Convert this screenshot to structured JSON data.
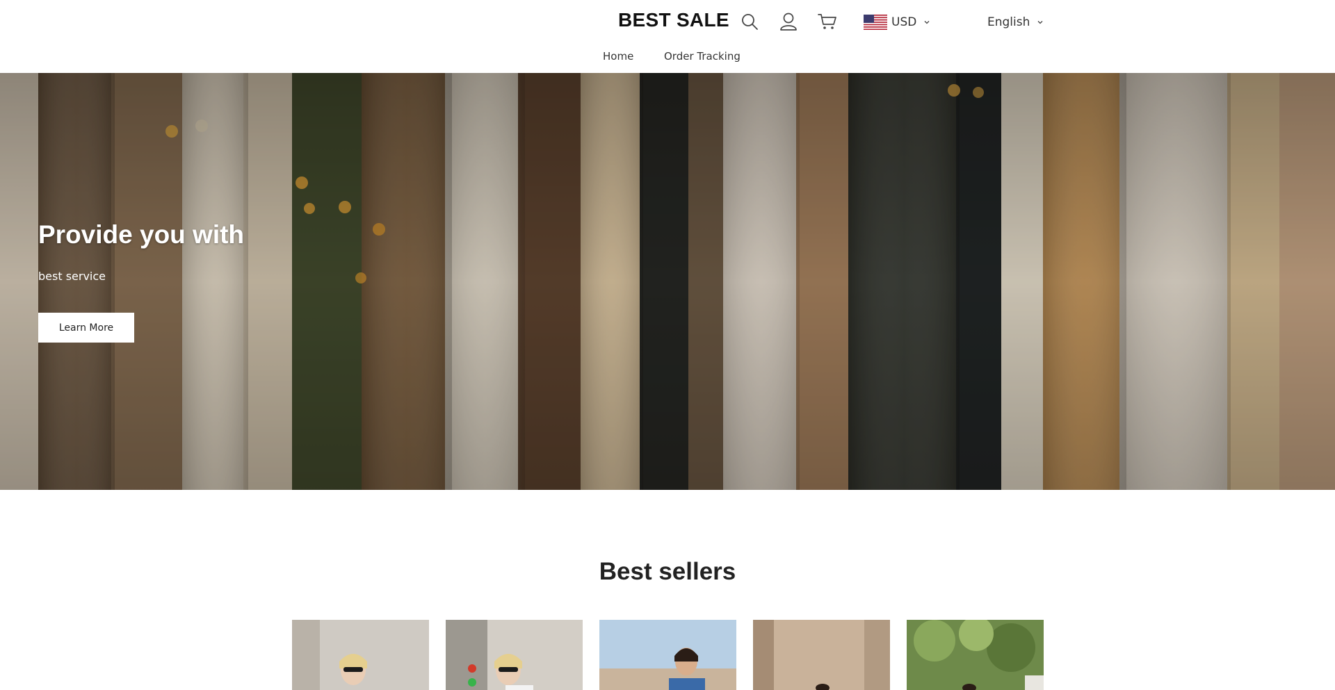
{
  "header": {
    "logo": "BEST SALE",
    "currency": {
      "code": "USD",
      "flag_icon": "us-flag-icon"
    },
    "language": "English",
    "icons": [
      "search-icon",
      "user-icon",
      "cart-icon"
    ]
  },
  "nav": {
    "items": [
      {
        "label": "Home"
      },
      {
        "label": "Order Tracking"
      }
    ]
  },
  "hero": {
    "title": "Provide you with",
    "subtitle": "best service",
    "button_label": "Learn More"
  },
  "best_sellers": {
    "title": "Best sellers",
    "products": [
      {
        "image": "product-image-1"
      },
      {
        "image": "product-image-2"
      },
      {
        "image": "product-image-3"
      },
      {
        "image": "product-image-4"
      },
      {
        "image": "product-image-5"
      }
    ]
  },
  "colors": {
    "text": "#222222",
    "background": "#ffffff",
    "hero_button_bg": "#ffffff"
  }
}
